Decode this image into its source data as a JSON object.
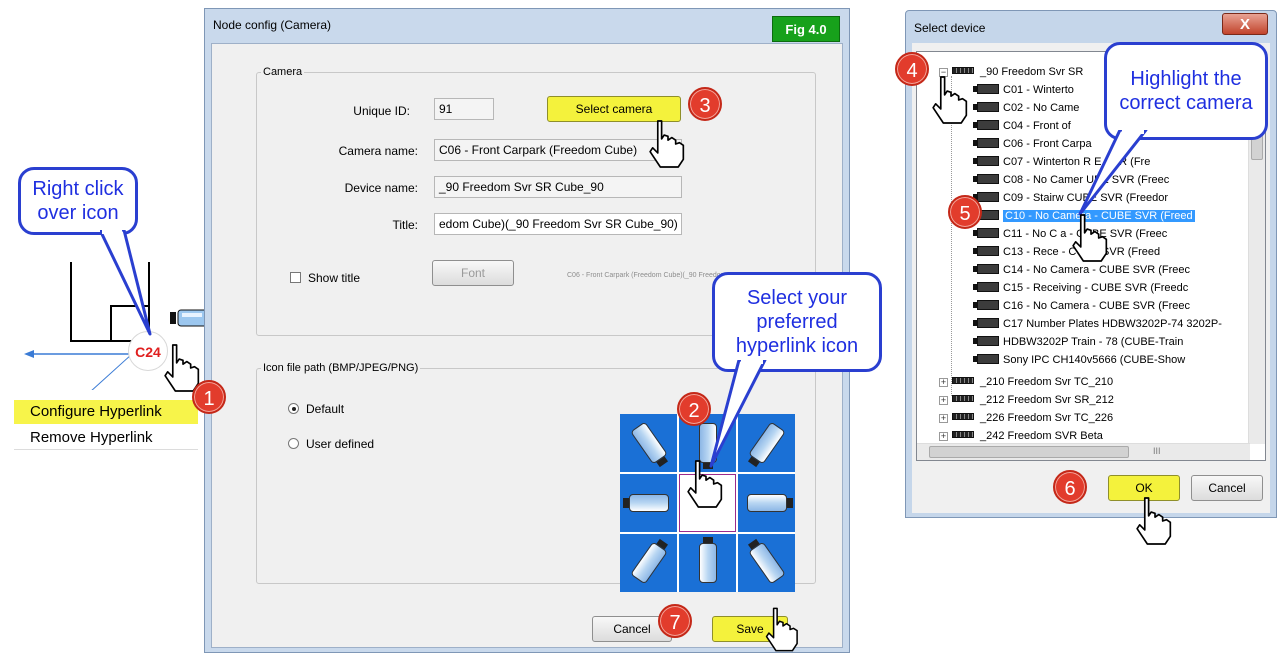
{
  "callouts": {
    "right_click": "Right click over icon",
    "select_icon": "Select your preferred hyperlink icon",
    "highlight": "Highlight the correct camera"
  },
  "badges": [
    "1",
    "2",
    "3",
    "4",
    "5",
    "6",
    "7"
  ],
  "context": {
    "marker_label": "C24",
    "menu_items": [
      "Configure Hyperlink",
      "Remove Hyperlink"
    ]
  },
  "node_config": {
    "title": "Node config (Camera)",
    "fig_label": "Fig 4.0",
    "camera_group": "Camera",
    "unique_id_label": "Unique ID:",
    "unique_id_value": "91",
    "select_camera_label": "Select camera",
    "camera_name_label": "Camera name:",
    "camera_name_value": "C06 - Front Carpark (Freedom Cube)",
    "device_name_label": "Device name:",
    "device_name_value": "_90  Freedom Svr SR Cube_90",
    "title_label": "Title:",
    "title_value": "edom Cube)(_90  Freedom Svr SR Cube_90)",
    "show_title_label": "Show title",
    "font_label": "Font",
    "preview_text": "C06 - Front Carpark (Freedom Cube)(_90  Freedom Svr SR Cr",
    "icon_group": "Icon file path (BMP/JPEG/PNG)",
    "default_label": "Default",
    "user_defined_label": "User defined",
    "cancel_label": "Cancel",
    "save_label": "Save"
  },
  "select_device": {
    "title": "Select device",
    "close_label": "X",
    "tree": {
      "root": "_90  Freedom Svr SR",
      "cameras": [
        "C01 - Winterto",
        "C02 - No Came",
        "C04 - Front of",
        "C06 - Front Carpa",
        "C07 - Winterton R      E SVR (Fre",
        "C08 - No Camer      UBE SVR (Freec",
        "C09 - Stairw      CUBE SVR (Freedor",
        "C10 - No Camera - CUBE SVR (Freed",
        "C11 - No C      a - CUBE SVR (Freec",
        "C13 - Rece      - CUBE SVR (Freed",
        "C14 - No Camera - CUBE SVR (Freec",
        "C15 - Receiving - CUBE SVR (Freedc",
        "C16 - No Camera - CUBE SVR (Freec",
        "C17 Number Plates HDBW3202P-74 3202P-",
        "HDBW3202P Train - 78 (CUBE-Train",
        "Sony IPC CH140v5666 (CUBE-Show"
      ],
      "selected_index": 7,
      "servers": [
        "_210 Freedom Svr TC_210",
        "_212 Freedom Svr SR_212",
        "_226 Freedom Svr TC_226",
        "_242 Freedom SVR Beta"
      ]
    },
    "scroll_mark": "III",
    "ok_label": "OK",
    "cancel_label": "Cancel"
  }
}
